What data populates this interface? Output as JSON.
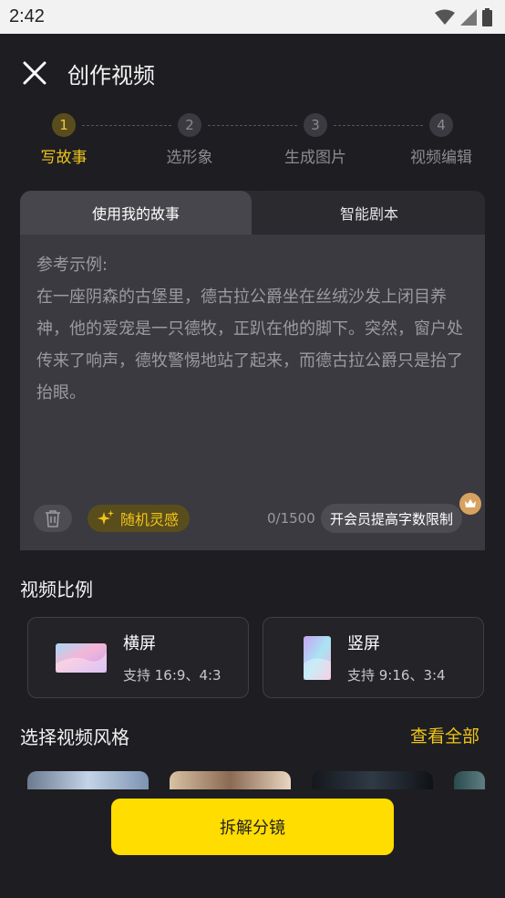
{
  "status_bar": {
    "time": "2:42"
  },
  "header": {
    "title": "创作视频"
  },
  "steps": [
    {
      "num": "1",
      "label": "写故事"
    },
    {
      "num": "2",
      "label": "选形象"
    },
    {
      "num": "3",
      "label": "生成图片"
    },
    {
      "num": "4",
      "label": "视频编辑"
    }
  ],
  "story": {
    "tabs": [
      "使用我的故事",
      "智能剧本"
    ],
    "placeholder_title": "参考示例:",
    "placeholder_body": "在一座阴森的古堡里，德古拉公爵坐在丝绒沙发上闭目养神，他的爱宠是一只德牧，正趴在他的脚下。突然，窗户处传来了响声，德牧警惕地站了起来，而德古拉公爵只是抬了抬眼。",
    "inspire_label": "随机灵感",
    "char_count": "0/1500",
    "vip_label": "开会员提高字数限制"
  },
  "ratio": {
    "title": "视频比例",
    "options": [
      {
        "name": "横屏",
        "desc": "支持 16:9、4:3"
      },
      {
        "name": "竖屏",
        "desc": "支持 9:16、3:4"
      }
    ]
  },
  "style": {
    "title": "选择视频风格",
    "view_all": "查看全部"
  },
  "bottom_button": "拆解分镜",
  "colors": {
    "accent": "#ffdd00",
    "highlight": "#f0c419",
    "background": "#1e1e22"
  }
}
